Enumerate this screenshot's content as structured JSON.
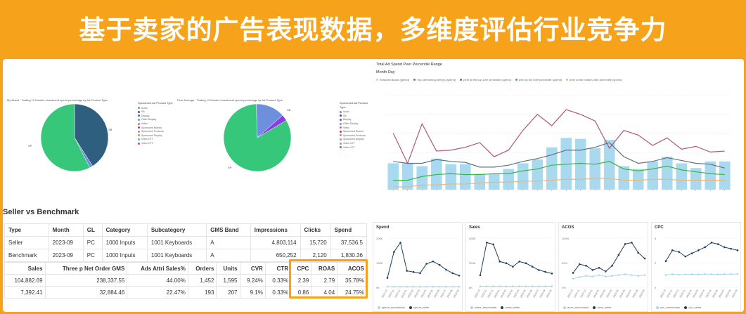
{
  "banner": {
    "title": "基于卖家的广告表现数据，多维度评估行业竞争力"
  },
  "colors": {
    "accent_orange": "#f7a21b",
    "pie_teal": "#2e5f7f",
    "pie_green": "#36c77a",
    "pie_blue": "#6e8fdc",
    "pie_purple": "#8a3de3",
    "bar_blue": "#a9d9ee",
    "line_red": "#b1586f",
    "line_slate": "#5d7383",
    "line_green": "#38b545",
    "line_orange": "#e8b77b"
  },
  "pie_left": {
    "title": "My Brand - Trailing 12 Months Investment spend percentage by Ad Product Type",
    "legend_title": "Sponsored Ad Product Type",
    "callout_right": "SB",
    "callout_left": "SP",
    "legend": [
      "Audio",
      "SB",
      "Display",
      "Other Display",
      "Video",
      "Sponsored Brands",
      "Sponsored Products",
      "Sponsored Display",
      "Video OTT",
      "Video OTT"
    ],
    "slices": [
      {
        "label": "SB",
        "value": 41,
        "color": "#2e5f7f"
      },
      {
        "label": "Display",
        "value": 1.5,
        "color": "#6e8fdc"
      },
      {
        "label": "SP",
        "value": 57.5,
        "color": "#36c77a"
      }
    ]
  },
  "pie_right": {
    "title": "Peer Average - Trailing 12 Months Investment spend percentage by Ad Product Type",
    "legend_title": "Sponsored Ad Product Type",
    "callout_right": "SB",
    "callout_left": "SP",
    "legend": [
      "Audio",
      "SB",
      "Display",
      "Other Display",
      "Video",
      "Sponsored Brands",
      "Sponsored Products",
      "Sponsored Display",
      "Video OTT",
      "Video OTT"
    ],
    "slices": [
      {
        "label": "SB",
        "value": 14,
        "color": "#6e8fdc"
      },
      {
        "label": "Display",
        "value": 3,
        "color": "#8a3de3"
      },
      {
        "label": "SP",
        "value": 83,
        "color": "#36c77a"
      }
    ]
  },
  "trend_chart": {
    "title": "Total Ad Spend Peer Percentile Range",
    "subtitle": "Month Day",
    "legend": [
      "Selected Brand (spend)",
      "peer at the top 10th percentile (spend)",
      "peer at the bottom 25th percentile (spend)",
      "peer at the 50th percentile (spend)",
      "Top performing peer(s) (spend)"
    ]
  },
  "chart_data": [
    {
      "type": "bar",
      "title": "Total Ad Spend Peer Percentile Range",
      "xlabel": "Month Day",
      "categories": [
        "1",
        "2",
        "3",
        "4",
        "5",
        "6",
        "7",
        "8",
        "9",
        "10",
        "11",
        "12",
        "13",
        "14",
        "15",
        "16",
        "17",
        "18",
        "19",
        "20",
        "21",
        "22",
        "23",
        "24"
      ],
      "series": [
        {
          "name": "Selected Brand (spend)",
          "kind": "bar",
          "values": [
            28,
            28,
            25,
            33,
            27,
            27,
            17,
            17,
            22,
            28,
            32,
            45,
            55,
            54,
            44,
            53,
            25,
            22,
            30,
            35,
            28,
            23,
            30,
            30
          ]
        },
        {
          "name": "Top performing peer(s) (spend)",
          "kind": "line",
          "values": [
            60,
            28,
            70,
            41,
            42,
            45,
            50,
            35,
            42,
            63,
            80,
            68,
            85,
            80,
            73,
            44,
            63,
            58,
            47,
            55,
            43,
            46,
            40,
            41
          ]
        },
        {
          "name": "peer at the top 10th percentile (spend)",
          "kind": "line",
          "values": [
            30,
            28,
            28,
            32,
            30,
            29,
            24,
            24,
            26,
            30,
            33,
            37,
            42,
            42,
            45,
            50,
            35,
            28,
            30,
            34,
            31,
            28,
            27,
            23
          ]
        },
        {
          "name": "peer at the 50th percentile (spend)",
          "kind": "line",
          "values": [
            10,
            10,
            14,
            16,
            17,
            16,
            16,
            17,
            17,
            20,
            22,
            26,
            27,
            28,
            27,
            30,
            22,
            20,
            22,
            25,
            21,
            19,
            17,
            16
          ]
        },
        {
          "name": "peer at the bottom 25th percentile (spend)",
          "kind": "line",
          "values": [
            3,
            3,
            5,
            5,
            6,
            6,
            7,
            8,
            8,
            9,
            9,
            10,
            11,
            11,
            12,
            12,
            10,
            10,
            11,
            11,
            10,
            10,
            10,
            10
          ]
        }
      ],
      "ylim": [
        0,
        100
      ]
    },
    {
      "type": "line",
      "title": "Spend",
      "categories": [
        "2022-10",
        "2022-11",
        "2022-12",
        "2023-01",
        "2023-02",
        "2023-03",
        "2023-04",
        "2023-05",
        "2023-06",
        "2023-07",
        "2023-08",
        "2023-09"
      ],
      "series": [
        {
          "name": "spend_benchmark",
          "values": [
            3,
            3,
            3,
            3,
            3,
            3,
            3,
            3,
            3,
            3,
            3,
            3
          ]
        },
        {
          "name": "spend_seller",
          "values": [
            40,
            150,
            190,
            70,
            65,
            60,
            100,
            110,
            95,
            75,
            60,
            50
          ]
        }
      ],
      "yticks": [
        "200K",
        "100K",
        "0K"
      ]
    },
    {
      "type": "line",
      "title": "Sales",
      "categories": [
        "2022-10",
        "2022-11",
        "2022-12",
        "2023-01",
        "2023-02",
        "2023-03",
        "2023-04",
        "2023-05",
        "2023-06",
        "2023-07",
        "2023-08",
        "2023-09"
      ],
      "series": [
        {
          "name": "sales_benchmark",
          "values": [
            3,
            3,
            3,
            3,
            3,
            3,
            3,
            3,
            3,
            3,
            3,
            3
          ]
        },
        {
          "name": "sales_seller",
          "values": [
            35,
            130,
            125,
            75,
            70,
            60,
            75,
            70,
            60,
            50,
            45,
            40
          ]
        }
      ],
      "yticks": [
        "400K",
        "200K",
        "0K"
      ]
    },
    {
      "type": "line",
      "title": "ACOS",
      "categories": [
        "2022-10",
        "2022-11",
        "2022-12",
        "2023-01",
        "2023-02",
        "2023-03",
        "2023-04",
        "2023-05",
        "2023-06",
        "2023-07",
        "2023-08",
        "2023-09"
      ],
      "series": [
        {
          "name": "acos_benchmark",
          "values": [
            12,
            14,
            16,
            15,
            17,
            15,
            16,
            17,
            18,
            17,
            16,
            17
          ]
        },
        {
          "name": "acos_seller",
          "values": [
            20,
            32,
            30,
            24,
            27,
            22,
            30,
            45,
            60,
            62,
            48,
            40
          ]
        }
      ],
      "yticks": [
        "100%",
        "50%",
        "0%"
      ]
    },
    {
      "type": "line",
      "title": "CPC",
      "categories": [
        "2022-10",
        "2022-11",
        "2022-12",
        "2023-01",
        "2023-02",
        "2023-03",
        "2023-04",
        "2023-05",
        "2023-06",
        "2023-07",
        "2023-08",
        "2023-09"
      ],
      "series": [
        {
          "name": "cpc_benchmark",
          "values": [
            0.8,
            0.85,
            0.82,
            0.83,
            0.85,
            0.84,
            0.86,
            0.85,
            0.84,
            0.85,
            0.86,
            0.86
          ]
        },
        {
          "name": "cpc_seller",
          "values": [
            1.7,
            2.4,
            2.3,
            2.0,
            2.2,
            2.4,
            2.6,
            2.9,
            2.8,
            2.6,
            2.5,
            2.4
          ]
        }
      ],
      "yticks": [
        "4",
        "2",
        "0"
      ]
    }
  ],
  "section": {
    "title": "Seller vs Benchmark"
  },
  "table1": {
    "headers": [
      "Type",
      "Month",
      "GL",
      "Category",
      "Subcategory",
      "GMS Band",
      "Impressions",
      "Clicks",
      "Spend"
    ],
    "rows": [
      [
        "Seller",
        "2023-09",
        "PC",
        "1000 Inputs",
        "1001 Keyboards",
        "A",
        "4,803,114",
        "15,720",
        "37,536.5"
      ],
      [
        "Benchmark",
        "2023-09",
        "PC",
        "1000 Inputs",
        "1001 Keyboards",
        "A",
        "650,252",
        "2,120",
        "1,830.36"
      ]
    ]
  },
  "table2": {
    "headers": [
      "Sales",
      "Three p Net Order GMS",
      "Ads Attri Sales%",
      "Orders",
      "Units",
      "CVR",
      "CTR",
      "CPC",
      "ROAS",
      "ACOS"
    ],
    "rows": [
      [
        "104,882.69",
        "238,337.55",
        "44.00%",
        "1,452",
        "1,595",
        "9.24%",
        "0.33%",
        "2.39",
        "2.79",
        "35.78%"
      ],
      [
        "7,392.41",
        "32,884.46",
        "22.47%",
        "193",
        "207",
        "9.1%",
        "0.33%",
        "0.86",
        "4.04",
        "24.75%"
      ]
    ]
  }
}
